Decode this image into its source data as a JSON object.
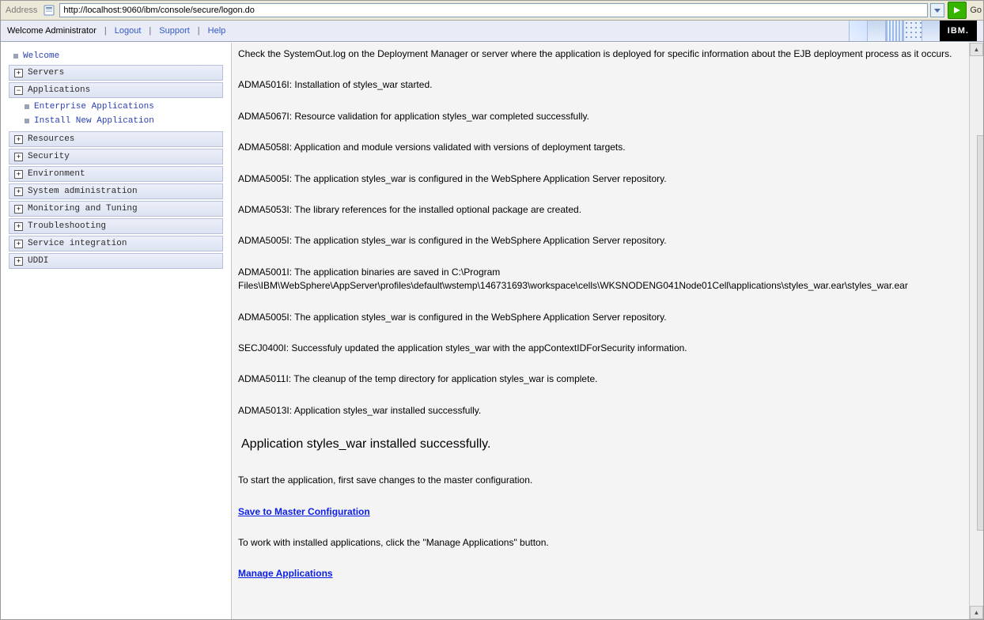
{
  "addressBar": {
    "label": "Address",
    "url": "http://localhost:9060/ibm/console/secure/logon.do",
    "go": "Go"
  },
  "banner": {
    "welcome": "Welcome Administrator",
    "logout": "Logout",
    "support": "Support",
    "help": "Help",
    "logo": "IBM."
  },
  "nav": {
    "welcome": "Welcome",
    "servers": "Servers",
    "applications": "Applications",
    "enterprise": "Enterprise Applications",
    "install_new": "Install New Application",
    "resources": "Resources",
    "security": "Security",
    "environment": "Environment",
    "sysadmin": "System administration",
    "monitoring": "Monitoring and Tuning",
    "trouble": "Troubleshooting",
    "serviceint": "Service integration",
    "uddi": "UDDI"
  },
  "messages": {
    "m0": "Check the SystemOut.log on the Deployment Manager or server where the application is deployed for specific information about the EJB deployment process as it occurs.",
    "m1": "ADMA5016I: Installation of styles_war started.",
    "m2": "ADMA5067I: Resource validation for application styles_war completed successfully.",
    "m3": "ADMA5058I: Application and module versions validated with versions of deployment targets.",
    "m4": "ADMA5005I: The application styles_war is configured in the WebSphere Application Server repository.",
    "m5": "ADMA5053I: The library references for the installed optional package are created.",
    "m6": "ADMA5005I: The application styles_war is configured in the WebSphere Application Server repository.",
    "m7": "ADMA5001I: The application binaries are saved in C:\\Program Files\\IBM\\WebSphere\\AppServer\\profiles\\default\\wstemp\\146731693\\workspace\\cells\\WKSNODENG041Node01Cell\\applications\\styles_war.ear\\styles_war.ear",
    "m8": "ADMA5005I: The application styles_war is configured in the WebSphere Application Server repository.",
    "m9": "SECJ0400I: Successfuly updated the application styles_war with the appContextIDForSecurity information.",
    "m10": "ADMA5011I: The cleanup of the temp directory for application styles_war is complete.",
    "m11": "ADMA5013I: Application styles_war installed successfully.",
    "big": "Application styles_war installed successfully.",
    "start_hint": "To start the application, first save changes to the master configuration.",
    "save_link": "Save to Master Configuration",
    "manage_hint": "To work with installed applications, click the \"Manage Applications\" button.",
    "manage_link": "Manage Applications"
  }
}
